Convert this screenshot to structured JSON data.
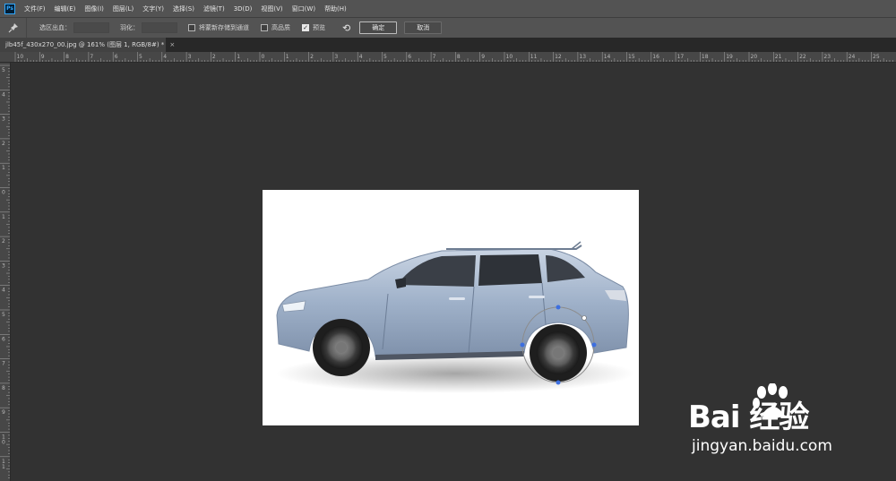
{
  "app": {
    "logo_text": "Ps",
    "menus": [
      "文件(F)",
      "编辑(E)",
      "图像(I)",
      "图层(L)",
      "文字(Y)",
      "选择(S)",
      "滤镜(T)",
      "3D(D)",
      "视图(V)",
      "窗口(W)",
      "帮助(H)"
    ]
  },
  "options_bar": {
    "tool_icon": "pin-icon",
    "output_label": "选区出血：",
    "feather_label": "羽化：",
    "save_to_channel_label": "将蒙新存储到通道",
    "save_to_channel_checked": false,
    "high_quality_label": "高品质",
    "high_quality_checked": false,
    "preview_label": "预览",
    "preview_checked": true,
    "reset_icon": "reset-icon",
    "ok_label": "确定",
    "cancel_label": "取消"
  },
  "document": {
    "tab_title": "jlb45f_430x270_00.jpg @ 161% (图层 1, RGB/8#) *",
    "close_glyph": "×"
  },
  "rulers": {
    "top_labels": [
      "10",
      "9",
      "8",
      "7",
      "6",
      "5",
      "4",
      "3",
      "2",
      "1",
      "0",
      "1",
      "2",
      "3",
      "4",
      "5",
      "6",
      "7",
      "8",
      "9",
      "10",
      "11",
      "12",
      "13",
      "14",
      "15",
      "16",
      "17",
      "18",
      "19",
      "20",
      "21",
      "22",
      "23",
      "24",
      "25"
    ],
    "left_labels": [
      "5",
      "4",
      "3",
      "2",
      "1",
      "0",
      "1",
      "2",
      "3",
      "4",
      "5",
      "6",
      "7",
      "8",
      "9",
      "1\n0",
      "1\n1"
    ]
  },
  "watermark": {
    "logo_text": "Bai 经验",
    "url": "jingyan.baidu.com"
  },
  "colors": {
    "menubar_bg": "#535353",
    "workspace_bg": "#323232",
    "car_body": "#9fb1c9",
    "selection_handle": "#3d6fe0"
  }
}
